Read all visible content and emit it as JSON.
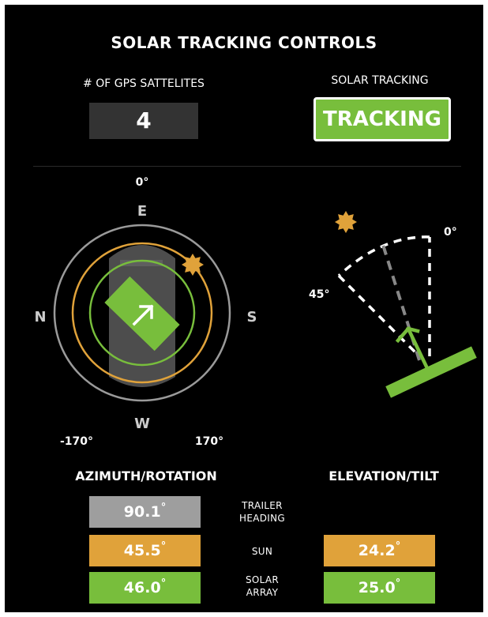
{
  "header": {
    "title": "SOLAR TRACKING CONTROLS"
  },
  "gps": {
    "label": "# OF GPS SATTELITES",
    "value": "4"
  },
  "tracking": {
    "label": "SOLAR TRACKING",
    "button_label": "TRACKING"
  },
  "compass": {
    "top_angle": "0°",
    "left_angle": "-170°",
    "right_angle": "170°",
    "north": "N",
    "east": "E",
    "south": "S",
    "west": "W"
  },
  "tilt": {
    "zero_label": "0°",
    "max_label": "45°"
  },
  "azimuth_section": {
    "title": "AZIMUTH/ROTATION"
  },
  "elevation_section": {
    "title": "ELEVATION/TILT"
  },
  "rows": {
    "trailer": {
      "label_line1": "TRAILER",
      "label_line2": "HEADING",
      "azimuth": "90.1",
      "deg": "°"
    },
    "sun": {
      "label": "SUN",
      "azimuth": "45.5",
      "elevation": "24.2",
      "deg": "°"
    },
    "array": {
      "label_line1": "SOLAR",
      "label_line2": "ARRAY",
      "azimuth": "46.0",
      "elevation": "25.0",
      "deg": "°"
    }
  },
  "colors": {
    "background": "#000000",
    "green": "#78be3c",
    "orange": "#e0a23a",
    "gray_box": "#9e9e9e",
    "dark_box": "#333333"
  },
  "icons": [
    "sun-icon",
    "arrow-up-right-icon"
  ]
}
